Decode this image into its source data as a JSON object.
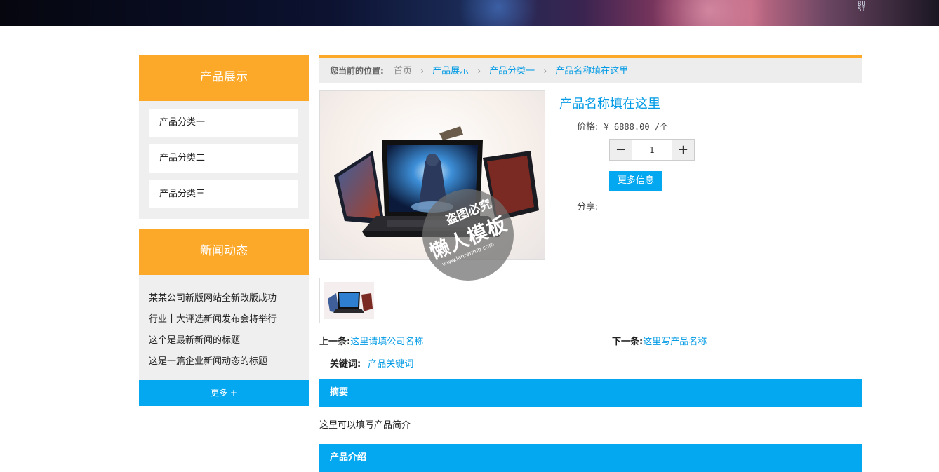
{
  "banner": {
    "vertical_text": "BUSI"
  },
  "sidebar": {
    "products": {
      "title": "产品展示",
      "items": [
        {
          "label": "产品分类一"
        },
        {
          "label": "产品分类二"
        },
        {
          "label": "产品分类三"
        }
      ]
    },
    "news": {
      "title": "新闻动态",
      "items": [
        {
          "label": "某某公司新版网站全新改版成功"
        },
        {
          "label": "行业十大评选新闻发布会将举行"
        },
        {
          "label": "这个是最新新闻的标题"
        },
        {
          "label": "这是一篇企业新闻动态的标题"
        }
      ],
      "more_label": "更多 +"
    }
  },
  "breadcrumb": {
    "label": "您当前的位置:",
    "home": "首页",
    "items": [
      "产品展示",
      "产品分类一",
      "产品名称填在这里"
    ]
  },
  "watermark": {
    "line1": "盗图必究",
    "line2": "懒人模板",
    "line3": "www.lanrenmb.com"
  },
  "product": {
    "title": "产品名称填在这里",
    "price_label": "价格:",
    "price": "¥ 6888.00 /个",
    "quantity": "1",
    "minus": "−",
    "plus": "+",
    "more_info_label": "更多信息",
    "share_label": "分享:"
  },
  "navigation": {
    "prev_label": "上一条:",
    "prev_link": "这里请填公司名称",
    "next_label": "下一条:",
    "next_link": "这里写产品名称",
    "keywords_label": "关键词:",
    "keywords_link": "产品关键词"
  },
  "sections": {
    "summary_title": "摘要",
    "summary_text": "这里可以填写产品简介",
    "intro_title": "产品介绍"
  },
  "colors": {
    "orange": "#fca829",
    "blue": "#03a8f0",
    "link": "#039be5"
  }
}
